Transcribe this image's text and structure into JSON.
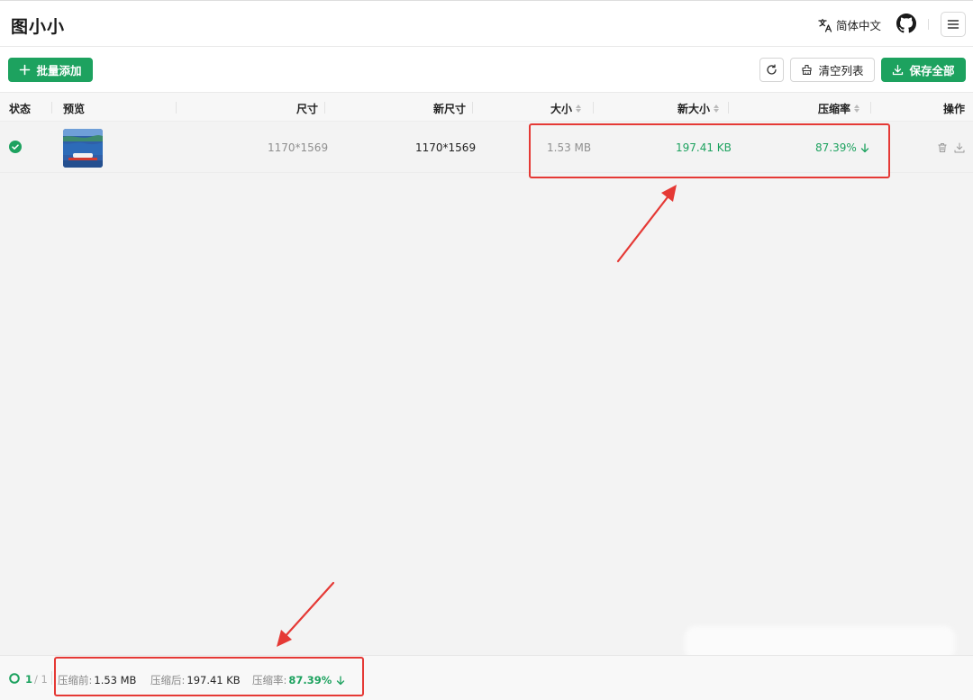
{
  "header": {
    "app_title": "图小小",
    "language_label": "简体中文"
  },
  "toolbar": {
    "add_label": "批量添加",
    "clear_label": "清空列表",
    "save_all_label": "保存全部"
  },
  "table": {
    "columns": {
      "status": "状态",
      "preview": "预览",
      "size": "尺寸",
      "new_size": "新尺寸",
      "file_size": "大小",
      "new_file_size": "新大小",
      "ratio": "压缩率",
      "actions": "操作"
    },
    "rows": [
      {
        "dimensions": "1170*1569",
        "new_dimensions": "1170*1569",
        "file_size": "1.53 MB",
        "new_file_size": "197.41 KB",
        "ratio": "87.39%"
      }
    ]
  },
  "footer": {
    "progress_done": "1",
    "progress_total": "/ 1",
    "before_label": "压缩前:",
    "before_value": "1.53 MB",
    "after_label": "压缩后:",
    "after_value": "197.41 KB",
    "ratio_label": "压缩率:",
    "ratio_value": "87.39%"
  },
  "colors": {
    "accent": "#1da25f",
    "annotation": "#e53935"
  }
}
